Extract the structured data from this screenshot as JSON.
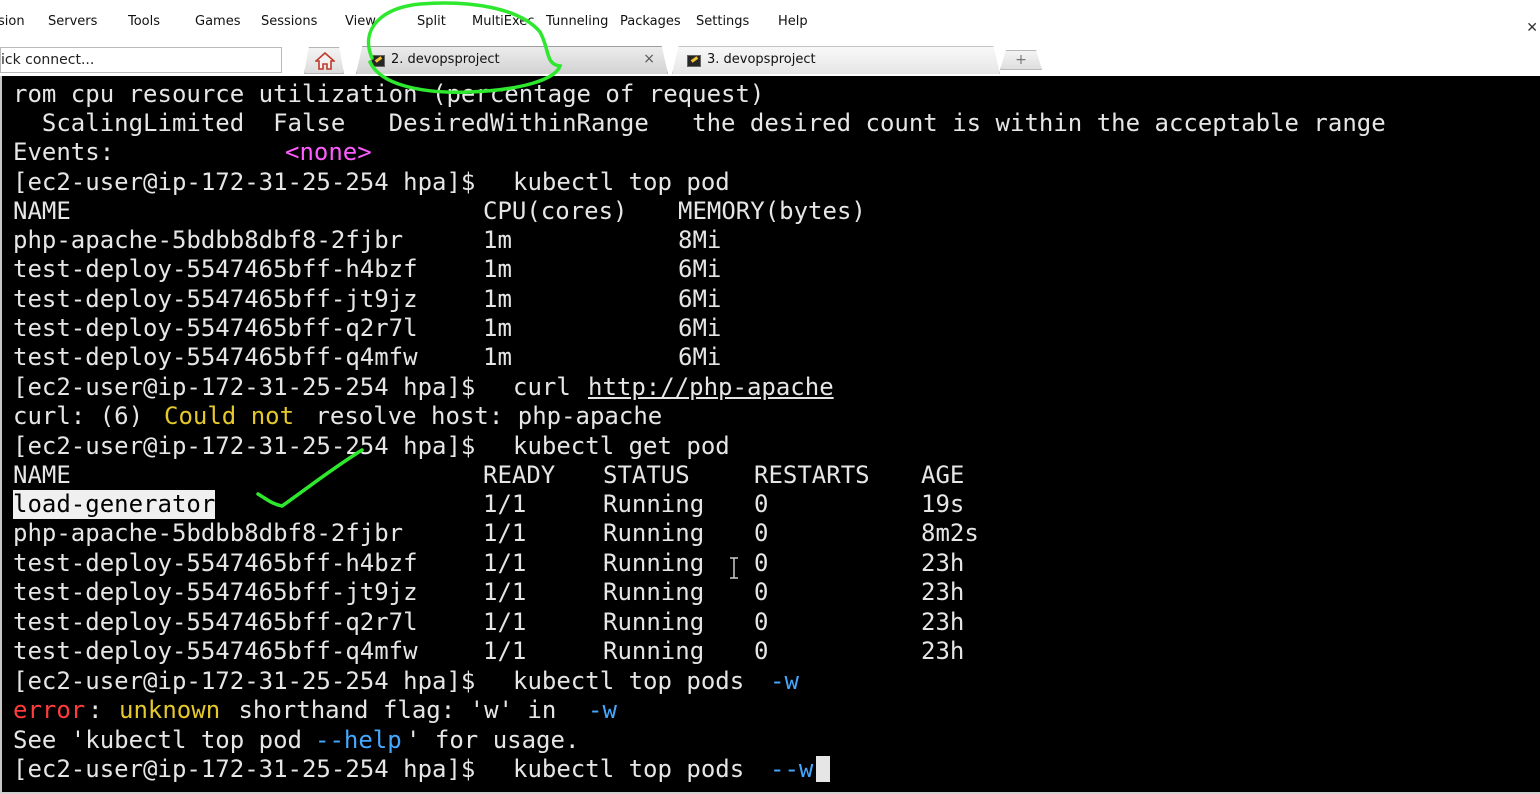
{
  "menu": [
    "sion",
    "Servers",
    "Tools",
    "Games",
    "Sessions",
    "View",
    "Split",
    "MultiExec",
    "Tunneling",
    "Packages",
    "Settings",
    "Help"
  ],
  "quick_connect": "ick connect...",
  "tabs": [
    {
      "label": "2. devopsproject",
      "active": true
    },
    {
      "label": "3. devopsproject",
      "active": false
    }
  ],
  "terminal": {
    "l1": "rom cpu resource utilization (percentage of request)",
    "l2": "  ScalingLimited  False   DesiredWithinRange   the desired count is within the acceptable range",
    "l3_label": "Events:",
    "l3_value": "<none>",
    "prompt": "[ec2-user@ip-172-31-25-254 hpa]$",
    "cmd_top_pod": "kubectl top pod",
    "top_headers": [
      "NAME",
      "CPU(cores)",
      "MEMORY(bytes)"
    ],
    "top_rows": [
      [
        "php-apache-5bdbb8dbf8-2fjbr",
        "1m",
        "8Mi"
      ],
      [
        "test-deploy-5547465bff-h4bzf",
        "1m",
        "6Mi"
      ],
      [
        "test-deploy-5547465bff-jt9jz",
        "1m",
        "6Mi"
      ],
      [
        "test-deploy-5547465bff-q2r7l",
        "1m",
        "6Mi"
      ],
      [
        "test-deploy-5547465bff-q4mfw",
        "1m",
        "6Mi"
      ]
    ],
    "cmd_curl": "curl",
    "curl_url": "http://php-apache",
    "curl_err_1": "curl: (6) ",
    "curl_err_2": "Could not",
    "curl_err_3": " resolve host: php-apache",
    "cmd_get_pod": "kubectl get pod",
    "get_headers": [
      "NAME",
      "READY",
      "STATUS",
      "RESTARTS",
      "AGE"
    ],
    "get_rows": [
      [
        "load-generator",
        "1/1",
        "Running",
        "0",
        "19s"
      ],
      [
        "php-apache-5bdbb8dbf8-2fjbr",
        "1/1",
        "Running",
        "0",
        "8m2s"
      ],
      [
        "test-deploy-5547465bff-h4bzf",
        "1/1",
        "Running",
        "0",
        "23h"
      ],
      [
        "test-deploy-5547465bff-jt9jz",
        "1/1",
        "Running",
        "0",
        "23h"
      ],
      [
        "test-deploy-5547465bff-q2r7l",
        "1/1",
        "Running",
        "0",
        "23h"
      ],
      [
        "test-deploy-5547465bff-q4mfw",
        "1/1",
        "Running",
        "0",
        "23h"
      ]
    ],
    "cmd_top_pods": "kubectl top pods",
    "flag_w": "-w",
    "err_word": "error",
    "err_unknown": "unknown",
    "err_rest": " shorthand flag: 'w' in ",
    "see_1": "See 'kubectl top pod ",
    "see_help": "--help",
    "see_2": "' for usage.",
    "flag_w2": "--w"
  },
  "colors": {
    "terminal_bg": "#000000",
    "terminal_fg": "#e6e6e6",
    "annotation": "#2ee82e"
  }
}
